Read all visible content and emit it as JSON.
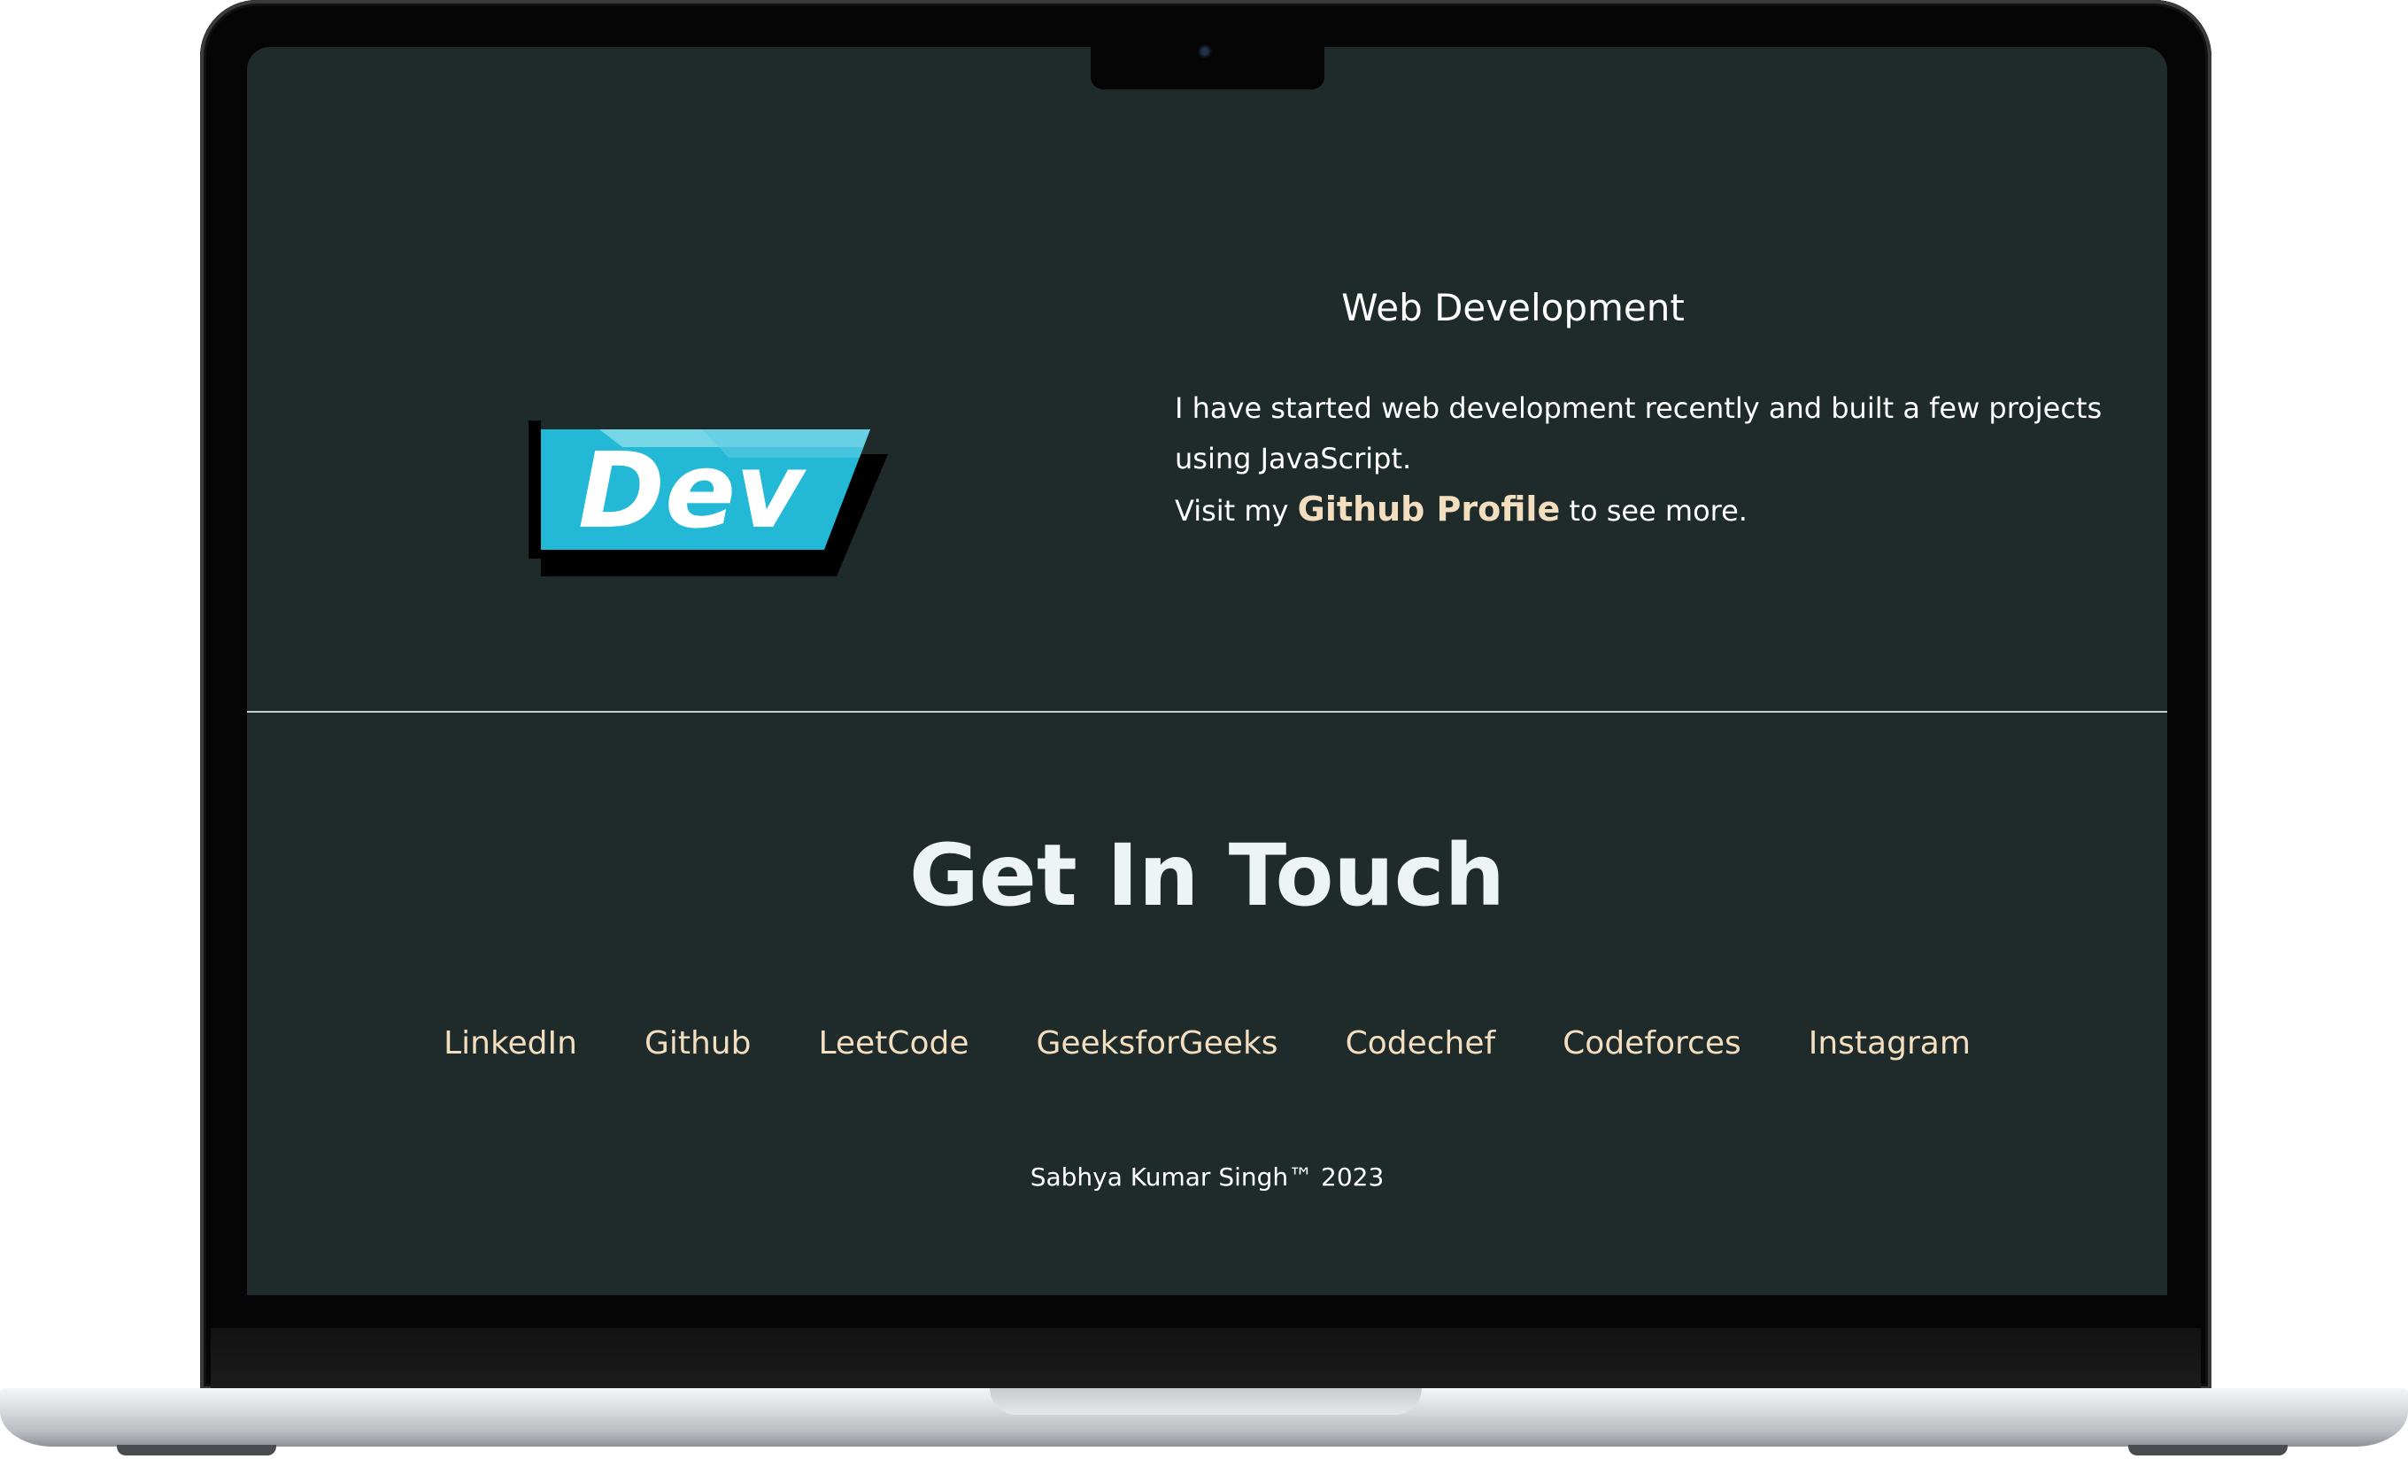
{
  "skill": {
    "title": "Web Development",
    "text_line1": "I have started web development recently and built a few projects using JavaScript.",
    "visit_prefix": "Visit my",
    "link_label": "Github Profile",
    "visit_suffix": "to see more.",
    "logo_text": "Dev"
  },
  "contact": {
    "title": "Get In Touch",
    "links": [
      "LinkedIn",
      "Github",
      "LeetCode",
      "GeeksforGeeks",
      "Codechef",
      "Codeforces",
      "Instagram"
    ]
  },
  "footer": {
    "copyright": "Sabhya Kumar Singh™ 2023"
  },
  "colors": {
    "background": "#1f2a2b",
    "link": "#f3dfbf",
    "logo": "#22b8d6"
  }
}
